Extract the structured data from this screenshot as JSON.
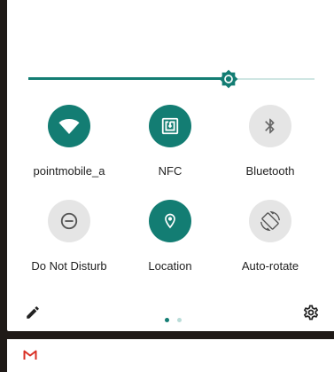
{
  "brightness": {
    "level": 0.7
  },
  "tiles": [
    {
      "label": "pointmobile_a",
      "icon": "wifi-icon",
      "active": true
    },
    {
      "label": "NFC",
      "icon": "nfc-icon",
      "active": true
    },
    {
      "label": "Bluetooth",
      "icon": "bluetooth-icon",
      "active": false
    },
    {
      "label": "Do Not Disturb",
      "icon": "do-not-disturb-icon",
      "active": false
    },
    {
      "label": "Location",
      "icon": "location-icon",
      "active": true
    },
    {
      "label": "Auto-rotate",
      "icon": "auto-rotate-icon",
      "active": false
    }
  ],
  "footer": {
    "edit_icon": "pencil-icon",
    "settings_icon": "gear-icon",
    "page_count": 2,
    "current_page": 1
  },
  "notification": {
    "app_icon": "gmail-icon"
  },
  "colors": {
    "accent": "#137d73",
    "inactive": "#e5e5e5",
    "accent_light": "#cfe6e3",
    "gmail": "#d93025"
  }
}
